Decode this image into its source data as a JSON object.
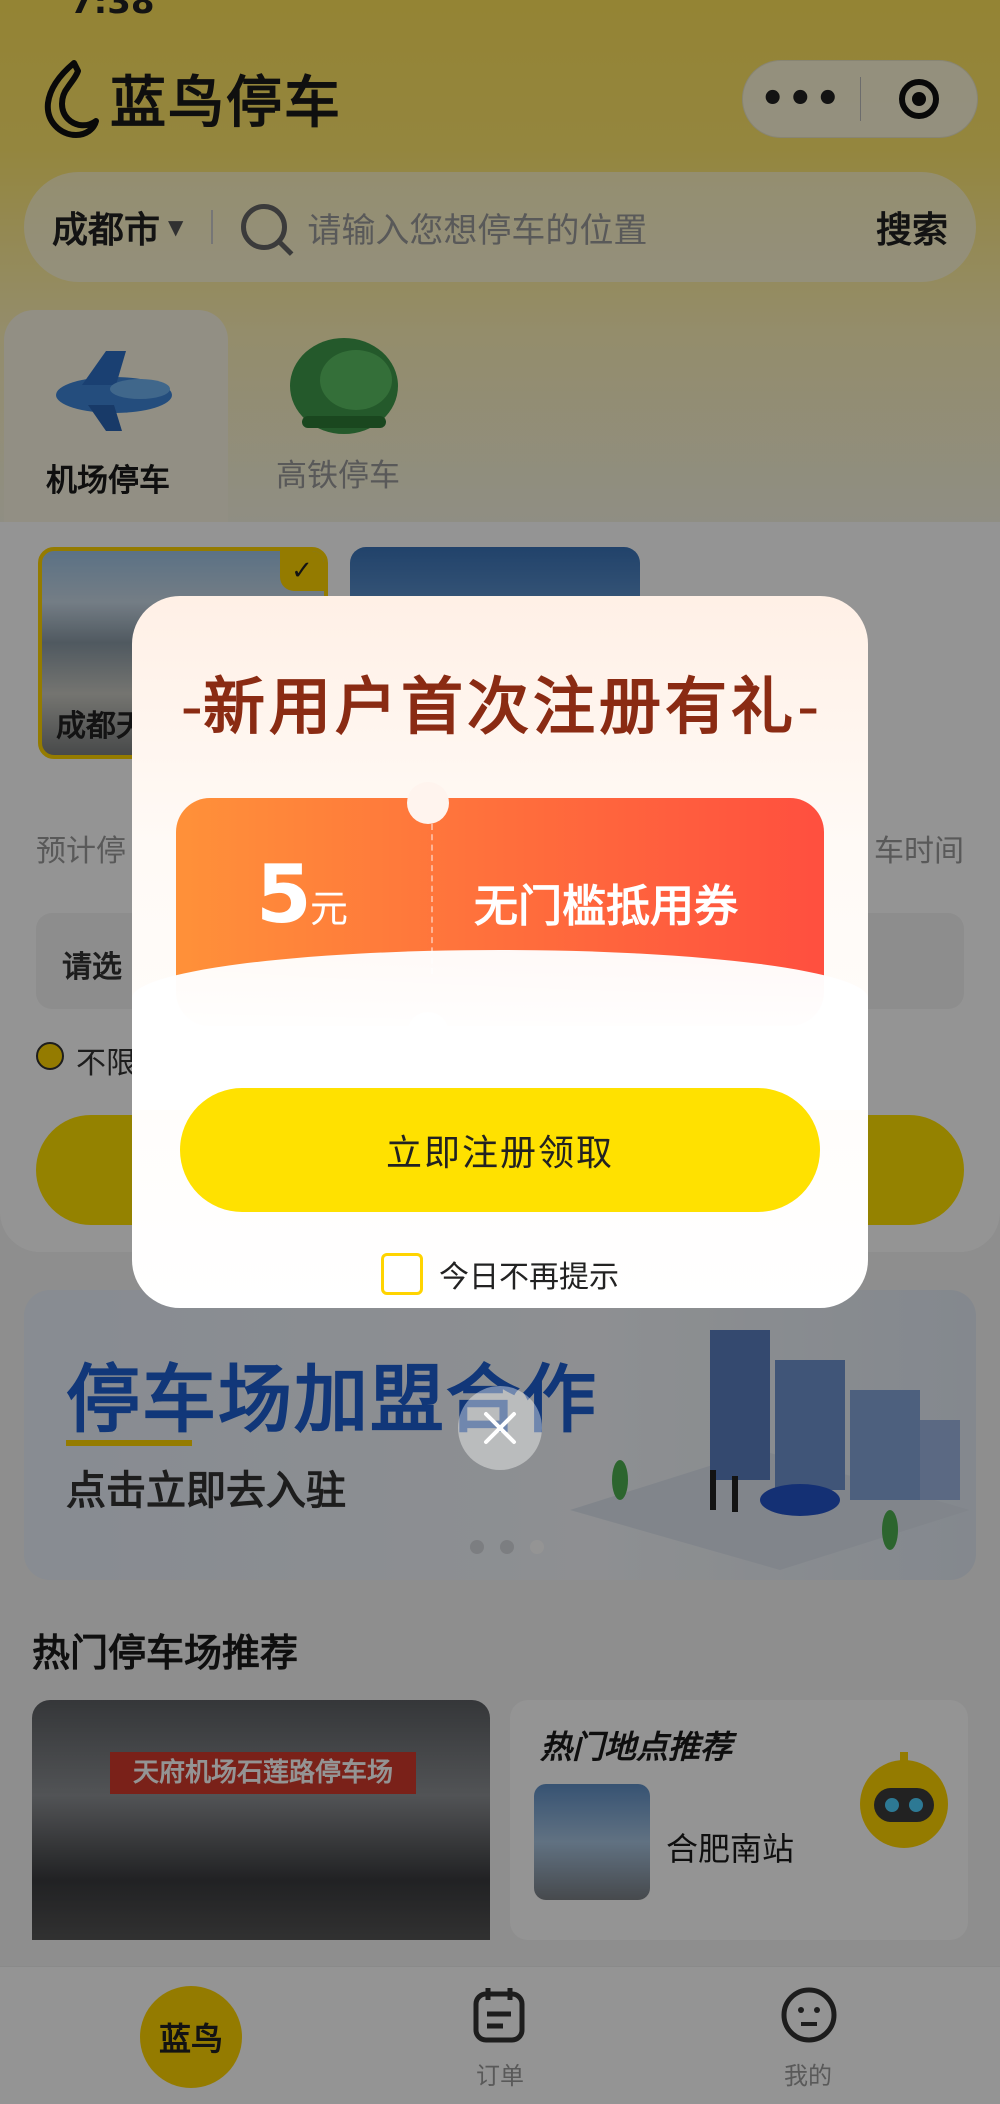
{
  "status_bar": {
    "time": "7:38"
  },
  "header": {
    "app_name": "蓝鸟停车",
    "city": "成都市",
    "search_placeholder": "请输入您想停车的位置",
    "search_button": "搜索"
  },
  "tabs": [
    {
      "label": "机场停车",
      "selected": true
    },
    {
      "label": "高铁停车",
      "selected": false
    }
  ],
  "main": {
    "selected_location_label": "成都天",
    "estimate_left": "预计停",
    "estimate_right": "车时间",
    "select_label": "请选",
    "no_limit_label": "不限"
  },
  "banner": {
    "title": "停车场加盟合作",
    "subtitle": "点击立即去入驻"
  },
  "hot": {
    "section_title": "热门停车场推荐",
    "lot_sign": "天府机场石莲路停车场",
    "places_title": "热门地点推荐",
    "places": [
      "合肥南站"
    ]
  },
  "bottom_nav": {
    "home": "蓝鸟",
    "orders": "订单",
    "mine": "我的"
  },
  "modal": {
    "title": "新用户首次注册有礼",
    "coupon_amount": "5",
    "coupon_unit": "元",
    "coupon_name": "无门槛抵用券",
    "claim_button": "立即注册领取",
    "dont_remind": "今日不再提示"
  },
  "colors": {
    "brand_yellow": "#FFE100",
    "modal_title": "#8A2B13",
    "coupon_start": "#FF9139",
    "coupon_end": "#FF4F3F",
    "banner_title": "#1E5FD0"
  }
}
